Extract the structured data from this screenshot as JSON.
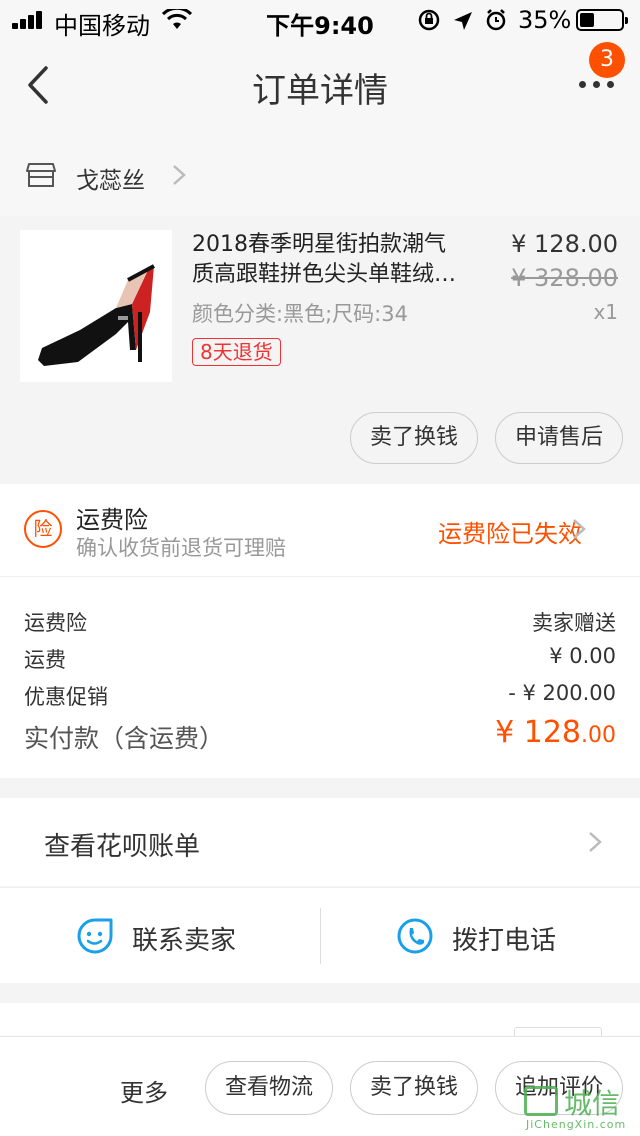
{
  "status_bar": {
    "carrier": "中国移动",
    "time": "下午9:40",
    "battery": "35%",
    "battery_level": 0.35
  },
  "nav": {
    "title": "订单详情",
    "badge_count": "3"
  },
  "shop": {
    "name": "戈蕊丝"
  },
  "item": {
    "title_line1": "2018春季明星街拍款潮气",
    "title_line2": "质高跟鞋拼色尖头单鞋绒…",
    "sku": "颜色分类:黑色;尺码:34",
    "tag": "8天退货",
    "price": "¥ 128.00",
    "original_price": "¥ 328.00",
    "quantity": "x1",
    "actions": {
      "sell": "卖了换钱",
      "after_sale": "申请售后"
    }
  },
  "insurance": {
    "badge": "险",
    "title": "运费险",
    "subtitle": "确认收货前退货可理赔",
    "status": "运费险已失效"
  },
  "fees": {
    "rows": [
      {
        "label": "运费险",
        "value": "卖家赠送"
      },
      {
        "label": "运费",
        "value": "¥ 0.00"
      },
      {
        "label": "优惠促销",
        "value": "- ¥ 200.00"
      }
    ],
    "total_label": "实付款（含运费）",
    "total_main": "¥ 128",
    "total_cents": ".00"
  },
  "huabei": {
    "label": "查看花呗账单"
  },
  "contact": {
    "seller_label": "联系卖家",
    "call_label": "拨打电话"
  },
  "bottom_bar": {
    "more": "更多",
    "logistics": "查看物流",
    "sell": "卖了换钱",
    "review": "追加评价"
  },
  "watermark": {
    "text": "城信",
    "sub": "JiChengXin.com"
  },
  "colors": {
    "accent": "#ff5000",
    "tag_red": "#e33",
    "contact_blue": "#1aa0e8"
  }
}
